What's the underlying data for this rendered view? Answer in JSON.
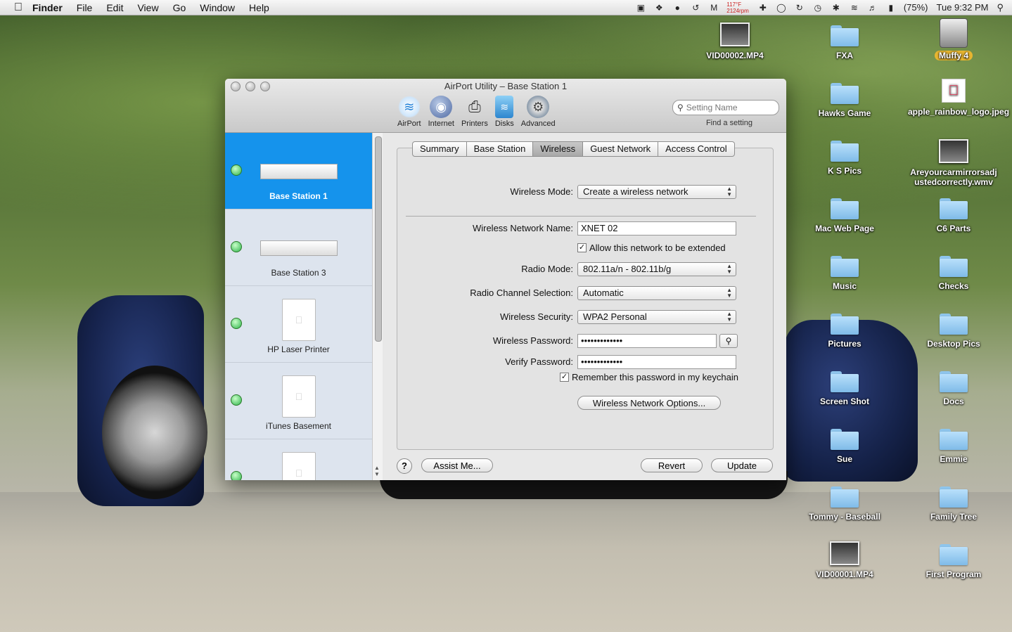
{
  "menubar": {
    "apple_icon": "apple-logo-icon",
    "app_name": "Finder",
    "items": [
      "File",
      "Edit",
      "View",
      "Go",
      "Window",
      "Help"
    ],
    "temperature": "117°F",
    "fan_speed": "2124rpm",
    "battery": "(75%)",
    "clock": "Tue 9:32 PM"
  },
  "desktop": {
    "icons": [
      {
        "label": "VID00002.MP4",
        "kind": "video"
      },
      {
        "label": "FXA",
        "kind": "folder"
      },
      {
        "label": "Muffy 4",
        "kind": "drive"
      },
      {
        "label": "Hawks Game",
        "kind": "folder"
      },
      {
        "label": "apple_rainbow_logo.jpeg",
        "kind": "image"
      },
      {
        "label": "K S Pics",
        "kind": "folder"
      },
      {
        "label": "Areyourcarmirrorsadjustedcorrectly.wmv",
        "kind": "video"
      },
      {
        "label": "Mac Web Page",
        "kind": "folder"
      },
      {
        "label": "C6 Parts",
        "kind": "folder"
      },
      {
        "label": "Music",
        "kind": "folder"
      },
      {
        "label": "Checks",
        "kind": "folder"
      },
      {
        "label": "Pictures",
        "kind": "folder"
      },
      {
        "label": "Desktop Pics",
        "kind": "folder"
      },
      {
        "label": "Screen Shot",
        "kind": "folder"
      },
      {
        "label": "Docs",
        "kind": "folder"
      },
      {
        "label": "Sue",
        "kind": "folder"
      },
      {
        "label": "Emmie",
        "kind": "folder"
      },
      {
        "label": "Tommy - Baseball",
        "kind": "folder"
      },
      {
        "label": "Family Tree",
        "kind": "folder"
      },
      {
        "label": "VID00001.MP4",
        "kind": "video"
      },
      {
        "label": "First Program",
        "kind": "folder"
      }
    ]
  },
  "window": {
    "title": "AirPort Utility – Base Station 1",
    "toolbar": {
      "airport": "AirPort",
      "internet": "Internet",
      "printers": "Printers",
      "disks": "Disks",
      "advanced": "Advanced"
    },
    "search": {
      "placeholder": "Setting Name",
      "caption": "Find a setting"
    },
    "devices": [
      "Base Station 1",
      "Base Station 3",
      "HP Laser Printer",
      "iTunes Basement"
    ],
    "selected_device": "Base Station 1",
    "tabs": [
      "Summary",
      "Base Station",
      "Wireless",
      "Guest Network",
      "Access Control"
    ],
    "active_tab": "Wireless",
    "form": {
      "wireless_mode_label": "Wireless Mode:",
      "wireless_mode_value": "Create a wireless network",
      "network_name_label": "Wireless Network Name:",
      "network_name_value": "XNET 02",
      "extend_label": "Allow this network to be extended",
      "radio_mode_label": "Radio Mode:",
      "radio_mode_value": "802.11a/n - 802.11b/g",
      "channel_label": "Radio Channel Selection:",
      "channel_value": "Automatic",
      "security_label": "Wireless Security:",
      "security_value": "WPA2 Personal",
      "password_label": "Wireless Password:",
      "password_value": "•••••••••••••",
      "verify_label": "Verify Password:",
      "verify_value": "•••••••••••••",
      "keychain_label": "Remember this password in my keychain",
      "options_button": "Wireless Network Options..."
    },
    "footer": {
      "help": "?",
      "assist": "Assist Me...",
      "revert": "Revert",
      "update": "Update"
    }
  }
}
